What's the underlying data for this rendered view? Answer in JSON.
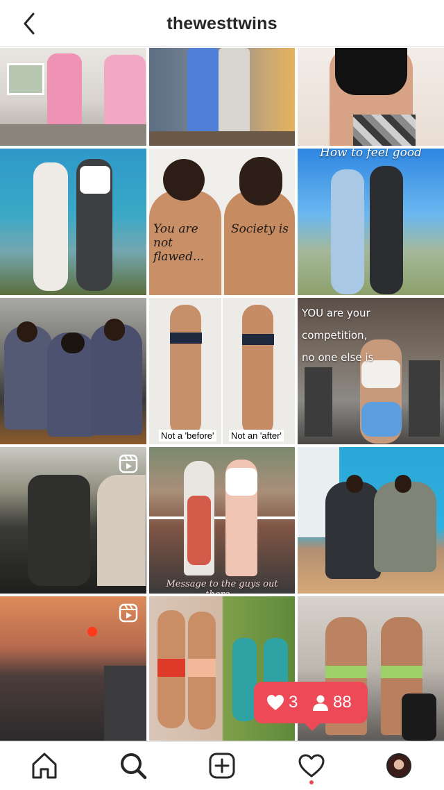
{
  "header": {
    "title": "thewesttwins"
  },
  "posts": [
    {
      "id": "p1",
      "alt": "twins-pink-activewear"
    },
    {
      "id": "p2",
      "alt": "leggings-legs"
    },
    {
      "id": "p3",
      "alt": "sports-bra-camo"
    },
    {
      "id": "p4",
      "alt": "twins-fence-back"
    },
    {
      "id": "p5",
      "alt": "backs-writing",
      "caption_left": "You are not flawed...",
      "caption_right": "Society is"
    },
    {
      "id": "p6",
      "alt": "how-to-feel-good",
      "caption_top": "How to feel good"
    },
    {
      "id": "p7",
      "alt": "robes-champagne"
    },
    {
      "id": "p8",
      "alt": "before-after",
      "tag_left": "Not a 'before'",
      "tag_right": "Not an 'after'"
    },
    {
      "id": "p9",
      "alt": "gym-quote",
      "caption_lines": [
        "YOU are your",
        "competition,",
        "no one else is"
      ]
    },
    {
      "id": "p10",
      "alt": "car-reel",
      "is_reel": true
    },
    {
      "id": "p11",
      "alt": "tennis-court",
      "caption_bottom": "Message to the guys out there..."
    },
    {
      "id": "p12",
      "alt": "twins-sitting-gym"
    },
    {
      "id": "p13",
      "alt": "sunset-reel",
      "is_reel": true
    },
    {
      "id": "p14",
      "alt": "then-and-now-collage"
    },
    {
      "id": "p15",
      "alt": "gym-backs"
    }
  ],
  "notification": {
    "likes": "3",
    "followers": "88"
  },
  "colors": {
    "notification_bg": "#ed4956",
    "text": "#262626",
    "divider": "#dbdbdb"
  },
  "nav": {
    "items": [
      "home-icon",
      "search-icon",
      "new-post-icon",
      "activity-icon",
      "profile-avatar"
    ]
  }
}
